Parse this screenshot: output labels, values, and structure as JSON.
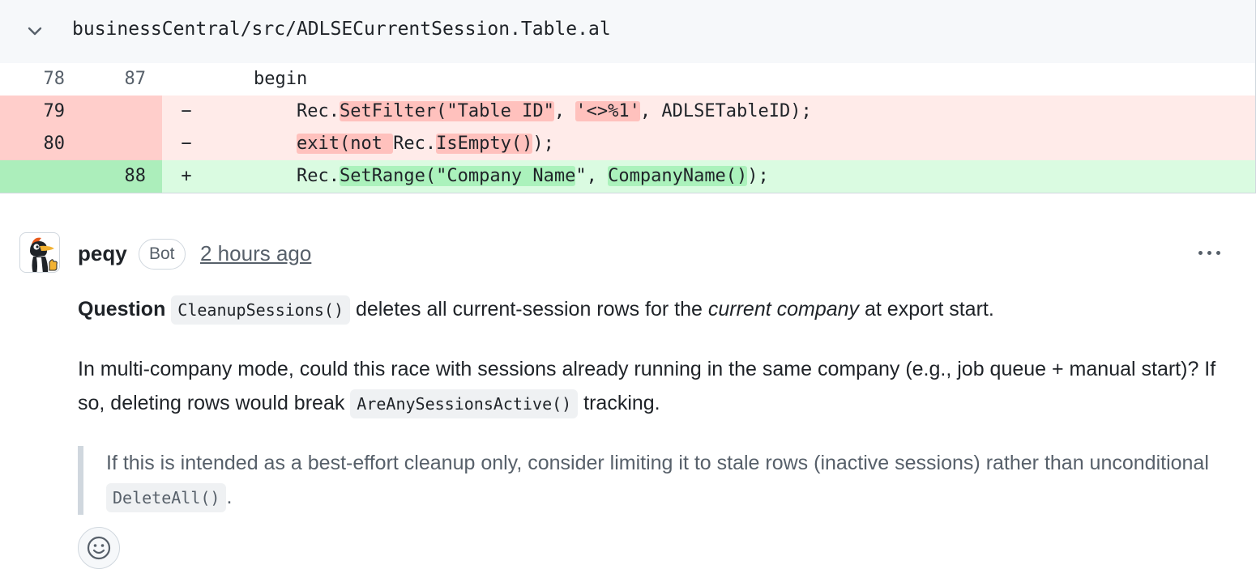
{
  "file": {
    "path": "businessCentral/src/ADLSECurrentSession.Table.al",
    "collapse_icon": "chevron-down-icon"
  },
  "diff": {
    "rows": [
      {
        "type": "context",
        "old": "78",
        "new": "87",
        "sign": "",
        "code_before": "    begin",
        "hl": "",
        "code_after": ""
      },
      {
        "type": "deleted",
        "old": "79",
        "new": "",
        "sign": "−"
      },
      {
        "type": "deleted",
        "old": "80",
        "new": "",
        "sign": "−"
      },
      {
        "type": "added",
        "old": "",
        "new": "88",
        "sign": "+"
      }
    ],
    "line79": {
      "a": "        Rec.",
      "b": "SetFilter(\"Table ID\"",
      "c": ", ",
      "d": "'<>%1'",
      "e": ", ADLSETableID);"
    },
    "line80": {
      "a": "        ",
      "b": "exit(not ",
      "c": "Rec.",
      "d": "IsEmpty()",
      "e": ");"
    },
    "line88": {
      "a": "        Rec.",
      "b": "SetRange(\"Company Name",
      "c": "\", ",
      "d": "CompanyName()",
      "e": ");"
    }
  },
  "comment": {
    "author": "peqy",
    "badge": "Bot",
    "timestamp": "2 hours ago",
    "avatar_icon": "woodpecker-avatar-icon",
    "menu_icon": "kebab-menu-icon",
    "p1": {
      "bold": "Question",
      "code": "CleanupSessions()",
      "text_a": " deletes all current-session rows for the ",
      "italic": "current company",
      "text_b": " at export start."
    },
    "p2": {
      "text_a": "In multi-company mode, could this race with sessions already running in the same company (e.g., job queue + manual start)? If so, deleting rows would break ",
      "code": "AreAnySessionsActive()",
      "text_b": " tracking."
    },
    "quote": {
      "text_a": "If this is intended as a best-effort cleanup only, consider limiting it to stale rows (inactive sessions) rather than unconditional ",
      "code": "DeleteAll()",
      "text_b": "."
    },
    "reaction_icon": "smiley-icon"
  }
}
